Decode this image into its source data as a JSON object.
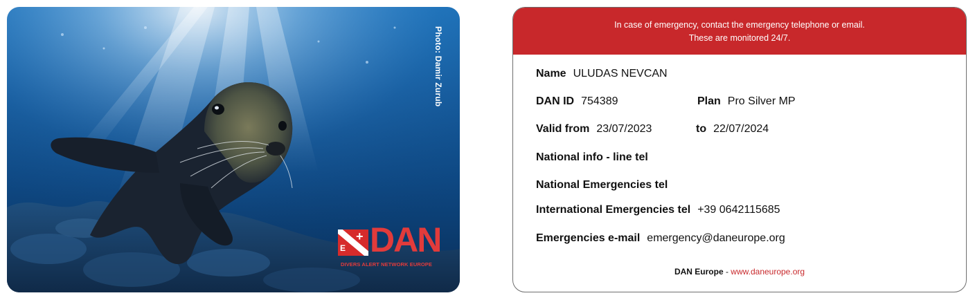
{
  "front": {
    "photo_credit": "Photo: Damir Zurub",
    "logo": {
      "flag_letter": "E",
      "wordmark": "DAN",
      "tagline": "DIVERS ALERT NETWORK EUROPE",
      "color": "#e23b3b"
    }
  },
  "back": {
    "banner": {
      "line1": "In case of emergency, contact the emergency telephone or email.",
      "line2": "These are monitored 24/7.",
      "color": "#c8282b"
    },
    "name_label": "Name",
    "name_value": "ULUDAS NEVCAN",
    "dan_id_label": "DAN ID",
    "dan_id_value": "754389",
    "plan_label": "Plan",
    "plan_value": "Pro Silver MP",
    "valid_from_label": "Valid from",
    "valid_from_value": "23/07/2023",
    "valid_to_label": "to",
    "valid_to_value": "22/07/2024",
    "national_info_label": "National info - line tel",
    "national_emergencies_label": "National Emergencies tel",
    "international_label": "International Emergencies tel",
    "international_value": "+39 0642115685",
    "email_label": "Emergencies e-mail",
    "email_value": "emergency@daneurope.org",
    "footer": {
      "org": "DAN Europe",
      "separator": " - ",
      "website": "www.daneurope.org"
    }
  }
}
